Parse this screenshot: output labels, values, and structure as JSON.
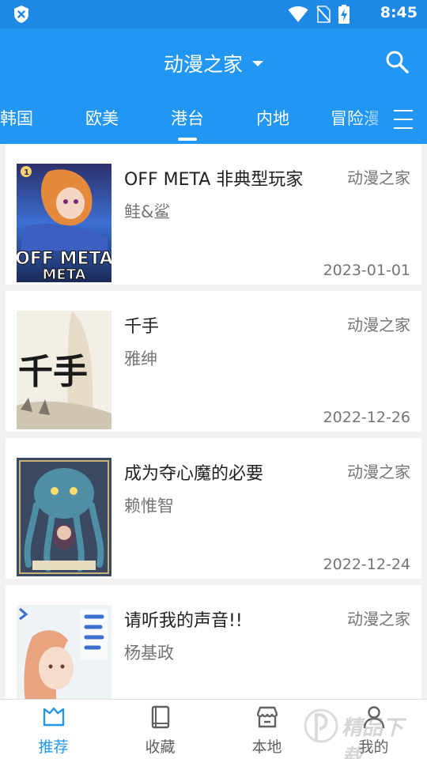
{
  "status_bar": {
    "time": "8:45"
  },
  "app_bar": {
    "title": "动漫之家"
  },
  "tabs": [
    {
      "label": "韩国"
    },
    {
      "label": "欧美"
    },
    {
      "label": "港台"
    },
    {
      "label": "内地"
    },
    {
      "label": "冒险漫"
    }
  ],
  "active_tab_index": 2,
  "comics": [
    {
      "title": "OFF META 非典型玩家",
      "author": "鲑&鲨",
      "source": "动漫之家",
      "date": "2023-01-01",
      "cover_text": "OFF META"
    },
    {
      "title": "千手",
      "author": "雅绅",
      "source": "动漫之家",
      "date": "2022-12-26",
      "cover_text": "千手"
    },
    {
      "title": "成为夺心魔的必要",
      "author": "赖惟智",
      "source": "动漫之家",
      "date": "2022-12-24",
      "cover_text": ""
    },
    {
      "title": "请听我的声音!!",
      "author": "杨基政",
      "source": "动漫之家",
      "date": "",
      "cover_text": ""
    }
  ],
  "bottom_nav": [
    {
      "label": "推荐",
      "icon": "recommend-icon",
      "active": true
    },
    {
      "label": "收藏",
      "icon": "book-icon",
      "active": false
    },
    {
      "label": "本地",
      "icon": "store-icon",
      "active": false
    },
    {
      "label": "我的",
      "icon": "person-icon",
      "active": false
    }
  ],
  "watermark": "精品下载",
  "colors": {
    "primary": "#2196f3",
    "status_bar": "#1e88e5",
    "text_primary": "#212121",
    "text_secondary": "#757575",
    "background": "#f2f2f2"
  }
}
